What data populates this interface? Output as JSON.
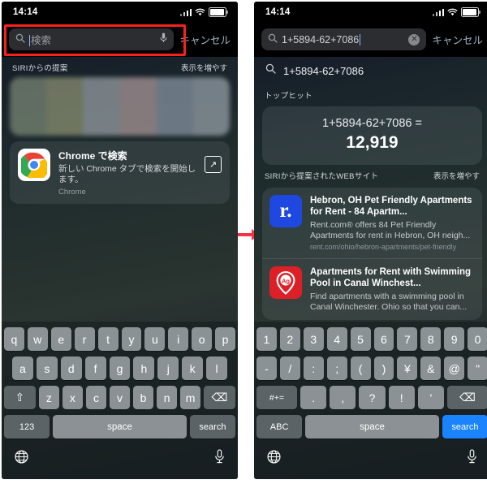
{
  "left": {
    "status": {
      "time": "14:14",
      "signal_icon": "cellular-bars-icon",
      "wifi_icon": "wifi-icon",
      "battery_icon": "battery-icon"
    },
    "search": {
      "placeholder": "検索",
      "value": "",
      "cancel_label": "キャンセル",
      "mic_icon": "microphone-icon",
      "search_icon": "search-icon",
      "highlight_color": "#fb2020"
    },
    "siri_section": {
      "title": "SIRIからの提案",
      "more_label": "表示を増やす"
    },
    "chrome_card": {
      "title": "Chrome で検索",
      "description": "新しい Chrome タブで検索を開始します。",
      "app": "Chrome",
      "open_icon": "open-external-icon"
    },
    "keyboard": {
      "row1": [
        "q",
        "w",
        "e",
        "r",
        "t",
        "y",
        "u",
        "i",
        "o",
        "p"
      ],
      "row2": [
        "a",
        "s",
        "d",
        "f",
        "g",
        "h",
        "j",
        "k",
        "l"
      ],
      "row3": [
        "z",
        "x",
        "c",
        "v",
        "b",
        "n",
        "m"
      ],
      "shift_label": "⇧",
      "backspace_label": "⌫",
      "num_label": "123",
      "space_label": "space",
      "return_label": "search",
      "globe_icon": "globe-icon",
      "mic_icon": "microphone-icon"
    }
  },
  "right": {
    "status": {
      "time": "14:14",
      "signal_icon": "cellular-bars-icon",
      "wifi_icon": "wifi-icon",
      "battery_icon": "battery-icon"
    },
    "search": {
      "placeholder": "検索",
      "value": "1+5894-62+7086",
      "cancel_label": "キャンセル",
      "clear_icon": "clear-circle-icon",
      "search_icon": "search-icon"
    },
    "suggestion_row": {
      "text": "1+5894-62+7086",
      "icon": "search-icon"
    },
    "top_hit": {
      "section_title": "トップヒット",
      "expression": "1+5894-62+7086 =",
      "result": "12,919"
    },
    "web_section": {
      "title": "SIRIから提案されたWEBサイト",
      "more_label": "表示を増やす"
    },
    "web_results": [
      {
        "favicon_text": "r.",
        "favicon_name": "rent-com-favicon",
        "favicon_color": "#1f48e0",
        "title": "Hebron, OH Pet Friendly Apartments for Rent - 84 Apartm...",
        "description": "Rent.com® offers 84 Pet Friendly Apartments for rent in Hebron, OH neigh...",
        "url": "rent.com/ohio/hebron-apartments/pet-friendly"
      },
      {
        "favicon_text": "Ag",
        "favicon_name": "apartmentguide-favicon",
        "favicon_color": "#dd2027",
        "title": "Apartments for Rent with Swimming Pool in Canal Winchest...",
        "description": "Find apartments with a swimming pool in Canal Winchester. Ohio so that you can...",
        "url": ""
      }
    ],
    "keyboard": {
      "row1": [
        "1",
        "2",
        "3",
        "4",
        "5",
        "6",
        "7",
        "8",
        "9",
        "0"
      ],
      "row2": [
        "-",
        "/",
        ":",
        ";",
        "(",
        ")",
        "¥",
        "&",
        "@",
        "\""
      ],
      "row3": [
        "#+=",
        ".",
        ",",
        "?",
        "!",
        "'",
        "⌫"
      ],
      "abc_label": "ABC",
      "space_label": "space",
      "return_label": "search",
      "return_color": "#1a84ff",
      "globe_icon": "globe-icon",
      "mic_icon": "microphone-icon"
    }
  },
  "flow_arrow": {
    "icon": "right-arrow-icon",
    "color": "#f5333f"
  }
}
